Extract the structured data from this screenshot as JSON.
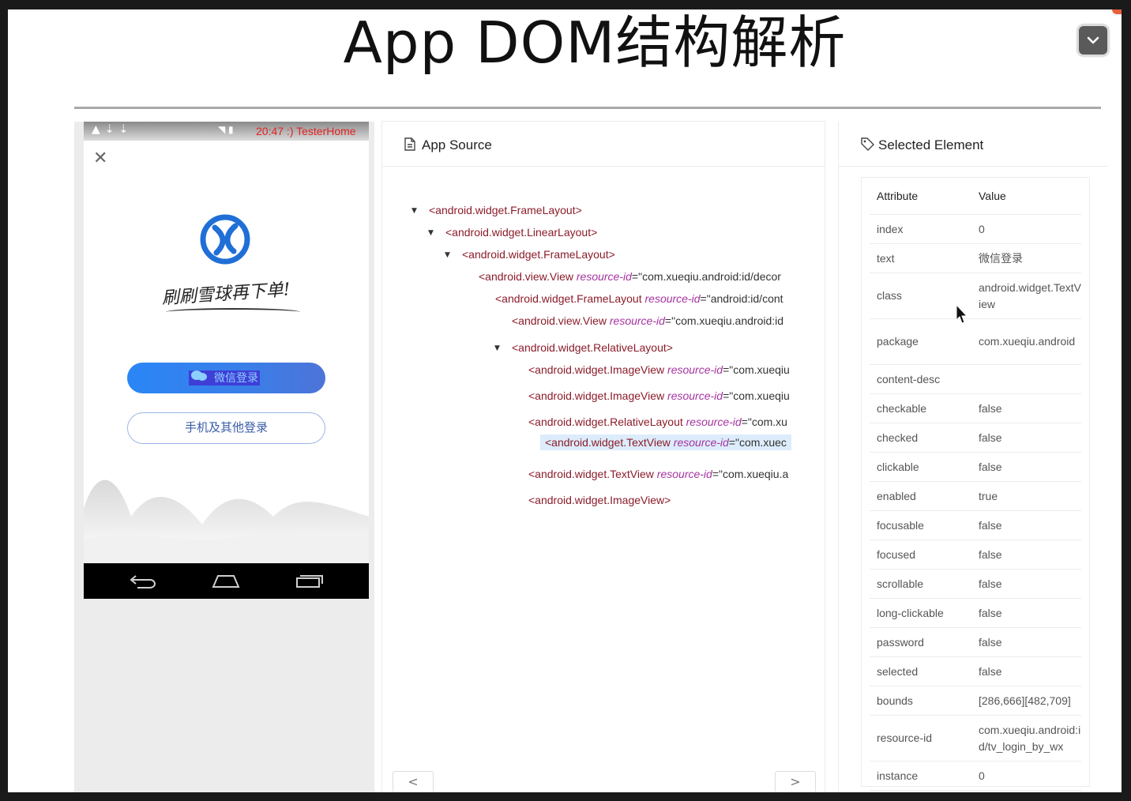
{
  "slide": {
    "title": "App DOM结构解析"
  },
  "phone": {
    "status_time": "20:47 :) TesterHome",
    "close_glyph": "✕",
    "slogan": "刷刷雪球再下单!",
    "wechat_button": "微信登录",
    "other_login_button": "手机及其他登录"
  },
  "source": {
    "title": "App Source",
    "rows": [
      {
        "caret": true,
        "tag": "<android.widget.FrameLayout>"
      },
      {
        "caret": true,
        "tag": "<android.widget.LinearLayout>"
      },
      {
        "caret": true,
        "tag": "<android.widget.FrameLayout>"
      },
      {
        "caret": true,
        "tag": "<android.view.View ",
        "attr": "resource-id",
        "value": "\"com.xueqiu.android:id/decor"
      },
      {
        "caret": true,
        "tag": "<android.widget.FrameLayout ",
        "attr": "resource-id",
        "value": "\"android:id/cont"
      },
      {
        "caret": false,
        "tag": "<android.view.View ",
        "attr": "resource-id",
        "value": "\"com.xueqiu.android:id"
      },
      {
        "caret": true,
        "tag": "<android.widget.RelativeLayout>"
      },
      {
        "caret": false,
        "tag": "<android.widget.ImageView ",
        "attr": "resource-id",
        "value": "\"com.xueqiu"
      },
      {
        "caret": false,
        "tag": "<android.widget.ImageView ",
        "attr": "resource-id",
        "value": "\"com.xueqiu"
      },
      {
        "caret": true,
        "tag": "<android.widget.RelativeLayout ",
        "attr": "resource-id",
        "value": "\"com.xu"
      },
      {
        "caret": false,
        "tag": "<android.widget.TextView ",
        "attr": "resource-id",
        "value": "\"com.xuec",
        "selected": true
      },
      {
        "caret": false,
        "tag": "<android.widget.TextView ",
        "attr": "resource-id",
        "value": "\"com.xueqiu.a"
      },
      {
        "caret": false,
        "tag": "<android.widget.ImageView>"
      }
    ],
    "prev_label": "<",
    "next_label": ">"
  },
  "element": {
    "title": "Selected Element",
    "header_attribute": "Attribute",
    "header_value": "Value",
    "rows": [
      {
        "name": "index",
        "value": "0"
      },
      {
        "name": "text",
        "value": "微信登录"
      },
      {
        "name": "class",
        "value": "android.widget.TextView"
      },
      {
        "name": "package",
        "value": "com.xueqiu.android"
      },
      {
        "name": "content-desc",
        "value": ""
      },
      {
        "name": "checkable",
        "value": "false"
      },
      {
        "name": "checked",
        "value": "false"
      },
      {
        "name": "clickable",
        "value": "false"
      },
      {
        "name": "enabled",
        "value": "true"
      },
      {
        "name": "focusable",
        "value": "false"
      },
      {
        "name": "focused",
        "value": "false"
      },
      {
        "name": "scrollable",
        "value": "false"
      },
      {
        "name": "long-clickable",
        "value": "false"
      },
      {
        "name": "password",
        "value": "false"
      },
      {
        "name": "selected",
        "value": "false"
      },
      {
        "name": "bounds",
        "value": "[286,666][482,709]"
      },
      {
        "name": "resource-id",
        "value": "com.xueqiu.android:id/tv_login_by_wx"
      },
      {
        "name": "instance",
        "value": "0"
      }
    ]
  },
  "colors": {
    "tag": "#8b1c2a",
    "attr": "#a533a0",
    "selected_bg": "#dcecfb",
    "wechat_blue": "#2a86f6",
    "status_red": "#e32222"
  }
}
